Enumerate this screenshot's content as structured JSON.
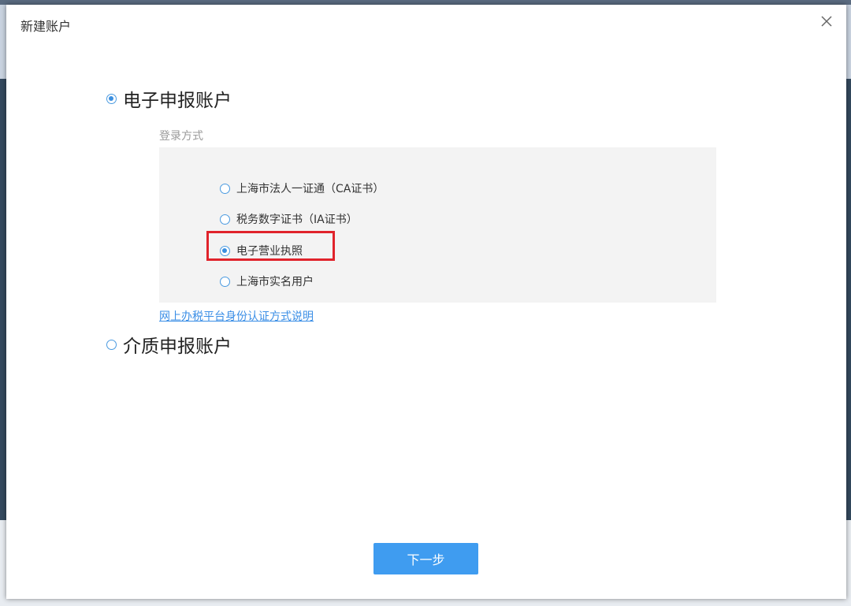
{
  "dialog": {
    "title": "新建账户",
    "close_icon": "close-icon"
  },
  "account_types": [
    {
      "label": "电子申报账户",
      "checked": true
    },
    {
      "label": "介质申报账户",
      "checked": false
    }
  ],
  "login_method": {
    "label": "登录方式",
    "options": [
      {
        "label": "上海市法人一证通（CA证书）",
        "checked": false
      },
      {
        "label": "税务数字证书（IA证书）",
        "checked": false
      },
      {
        "label": "电子营业执照",
        "checked": true
      },
      {
        "label": "上海市实名用户",
        "checked": false
      }
    ]
  },
  "help_link": "网上办税平台身份认证方式说明",
  "next_button": "下一步",
  "colors": {
    "accent": "#3f9cf0",
    "radio": "#3b8fe0",
    "highlight": "#e0232b",
    "panel_bg": "#f3f3f3",
    "link": "#3a8ee6"
  }
}
